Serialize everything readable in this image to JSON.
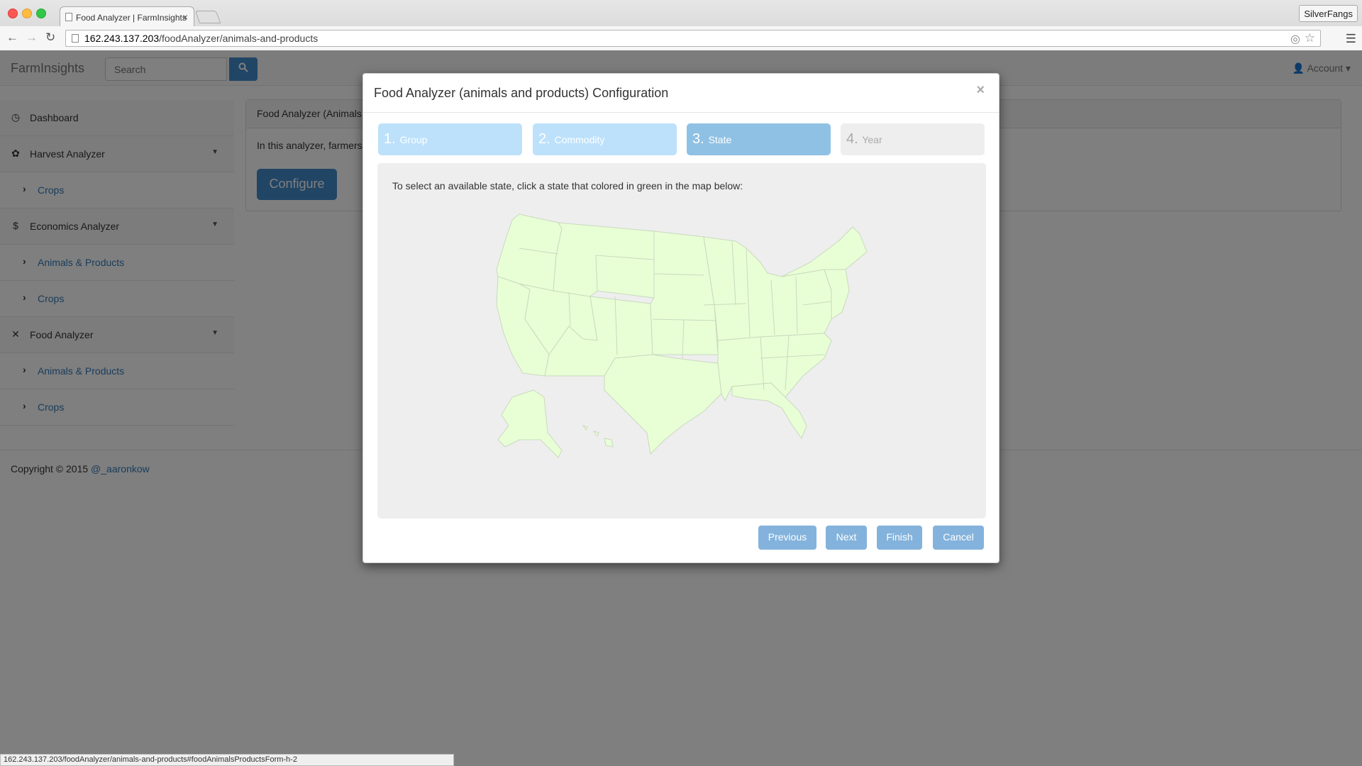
{
  "browser": {
    "tab_title": "Food Analyzer | FarmInsights",
    "tab_close": "×",
    "profile": "SilverFangs",
    "url_host": "162.243.137.203",
    "url_path": "/foodAnalyzer/animals-and-products",
    "icons": {
      "back": "arrow-left-icon",
      "forward": "arrow-right-icon",
      "reload": "reload-icon",
      "star": "star-icon",
      "menu": "hamburger-menu-icon"
    }
  },
  "navbar": {
    "brand": "FarmInsights",
    "search_placeholder": "Search",
    "account": "Account"
  },
  "sidebar": {
    "items": [
      {
        "label": "Dashboard"
      },
      {
        "label": "Harvest Analyzer"
      },
      {
        "label": "Crops"
      },
      {
        "label": "Economics Analyzer"
      },
      {
        "label": "Animals & Products"
      },
      {
        "label": "Crops"
      },
      {
        "label": "Food Analyzer"
      },
      {
        "label": "Animals & Products"
      },
      {
        "label": "Crops"
      }
    ]
  },
  "content": {
    "panel_heading": "Food Analyzer (Animals",
    "panel_text": "In this analyzer, farmers",
    "configure_label": "Configure"
  },
  "footer": {
    "copyright": "Copyright © 2015 ",
    "author_link": "@_aaronkow"
  },
  "modal": {
    "title": "Food Analyzer (animals and products) Configuration",
    "close": "×",
    "steps": [
      {
        "num": "1.",
        "label": "Group",
        "state": "done"
      },
      {
        "num": "2.",
        "label": "Commodity",
        "state": "done"
      },
      {
        "num": "3.",
        "label": "State",
        "state": "current"
      },
      {
        "num": "4.",
        "label": "Year",
        "state": "disabled"
      }
    ],
    "instruction": "To select an available state, click a state that colored in green in the map below:",
    "map_fill_color": "#e8ffd6",
    "buttons": {
      "previous": "Previous",
      "next": "Next",
      "finish": "Finish",
      "cancel": "Cancel"
    }
  },
  "status_bar": "162.243.137.203/foodAnalyzer/animals-and-products#foodAnimalsProductsForm-h-2",
  "colors": {
    "primary": "#428bca",
    "step_done": "#bde1fb",
    "step_current": "#8fc1e4",
    "map_green": "#e8ffd6"
  }
}
